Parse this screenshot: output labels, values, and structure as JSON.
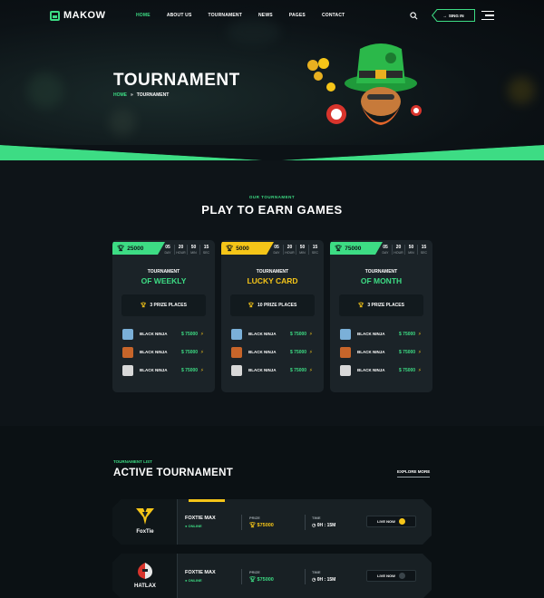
{
  "brand": {
    "name": "MAKOW"
  },
  "nav": {
    "items": [
      "HOME",
      "ABOUT US",
      "TOURNAMENT",
      "NEWS",
      "PAGES",
      "CONTACT"
    ],
    "active": "HOME"
  },
  "header": {
    "signin_label": "SING IN"
  },
  "hero": {
    "title": "TOURNAMENT",
    "breadcrumb_home": "HOME",
    "breadcrumb_sep": "»",
    "breadcrumb_current": "TOURNAMENT"
  },
  "section_games": {
    "eyebrow": "OUR TOURNAMENT",
    "title": "PLAY TO EARN GAMES"
  },
  "cards": [
    {
      "prize": "25000",
      "accent": "#3ddc84",
      "timer": [
        "05",
        "20",
        "50",
        "15"
      ],
      "timer_labels": [
        "DAY",
        "HOUR",
        "MIN",
        "SEC"
      ],
      "subtitle": "TOURNAMENT",
      "name": "OF WEEKLY",
      "places": "3 PRIZE PLACES",
      "players": [
        {
          "name": "BLACK NINJA",
          "value": "$ 75000"
        },
        {
          "name": "BLACK NINJA",
          "value": "$ 75000"
        },
        {
          "name": "BLACK NINJA",
          "value": "$ 75000"
        }
      ]
    },
    {
      "prize": "5000",
      "accent": "#f5c518",
      "timer": [
        "05",
        "20",
        "50",
        "15"
      ],
      "timer_labels": [
        "DAY",
        "HOUR",
        "MIN",
        "SEC"
      ],
      "subtitle": "TOURNAMENT",
      "name": "LUCKY CARD",
      "places": "10 PRIZE PLACES",
      "players": [
        {
          "name": "BLACK NINJA",
          "value": "$ 75000"
        },
        {
          "name": "BLACK NINJA",
          "value": "$ 75000"
        },
        {
          "name": "BLACK NINJA",
          "value": "$ 75000"
        }
      ]
    },
    {
      "prize": "75000",
      "accent": "#3ddc84",
      "timer": [
        "05",
        "20",
        "50",
        "15"
      ],
      "timer_labels": [
        "DAY",
        "HOUR",
        "MIN",
        "SEC"
      ],
      "subtitle": "TOURNAMENT",
      "name": "OF MONTH",
      "places": "3 PRIZE PLACES",
      "players": [
        {
          "name": "BLACK NINJA",
          "value": "$ 75000"
        },
        {
          "name": "BLACK NINJA",
          "value": "$ 75000"
        },
        {
          "name": "BLACK NINJA",
          "value": "$ 75000"
        }
      ]
    }
  ],
  "section_active": {
    "eyebrow": "TOURNAMENT LIST",
    "title": "ACTIVE TOURNAMENT",
    "explore": "EXPLORE MORE"
  },
  "tournaments": [
    {
      "logo": "FoxTie",
      "name": "FOXTIE MAX",
      "status": "ONLINE",
      "prize_label": "PRIZE",
      "prize": "$75000",
      "time_label": "TIME",
      "time": "0H : 15M",
      "button": "LIVE NOW"
    },
    {
      "logo": "HATLAX",
      "name": "FOXTIE MAX",
      "status": "ONLINE",
      "prize_label": "PRIZE",
      "prize": "$75000",
      "time_label": "TIME",
      "time": "0H : 15M",
      "button": "LIVE NOW"
    }
  ],
  "colors": {
    "accent_green": "#3ddc84",
    "accent_yellow": "#f5c518",
    "background": "#0e1418",
    "card": "#1b2328"
  }
}
